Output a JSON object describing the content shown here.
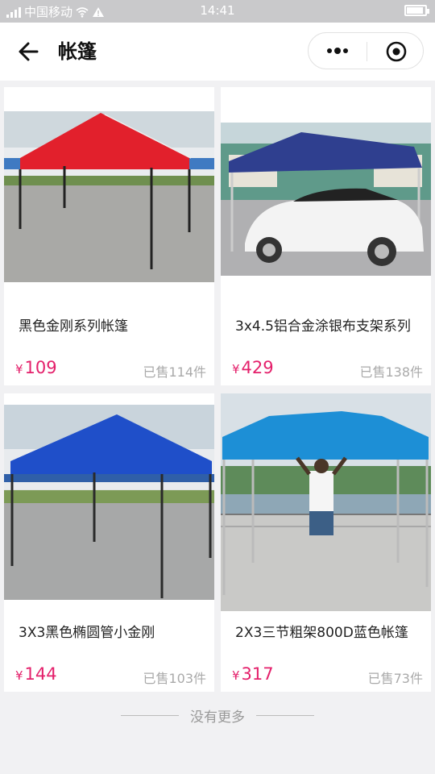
{
  "status_bar": {
    "carrier": "中国移动",
    "time": "14:41"
  },
  "nav": {
    "title": "帐篷"
  },
  "products": [
    {
      "title": "黑色金刚系列帐篷",
      "price_symbol": "¥",
      "price": "109",
      "sold": "已售114件",
      "canopy_color": "#e2202c",
      "image_icon": "red-tent-image"
    },
    {
      "title": "3x4.5铝合金涂银布支架系列",
      "price_symbol": "¥",
      "price": "429",
      "sold": "已售138件",
      "canopy_color": "#2f3f8f",
      "image_icon": "navy-tent-car-image"
    },
    {
      "title": "3X3黑色椭圆管小金刚",
      "price_symbol": "¥",
      "price": "144",
      "sold": "已售103件",
      "canopy_color": "#1f4fc9",
      "image_icon": "blue-tent-image"
    },
    {
      "title": "2X3三节粗架800D蓝色帐篷",
      "price_symbol": "¥",
      "price": "317",
      "sold": "已售73件",
      "canopy_color": "#1d8fd6",
      "image_icon": "sky-blue-tent-image"
    }
  ],
  "footer": {
    "no_more": "没有更多"
  },
  "colors": {
    "price": "#e4206b",
    "background": "#f1f1f3"
  }
}
